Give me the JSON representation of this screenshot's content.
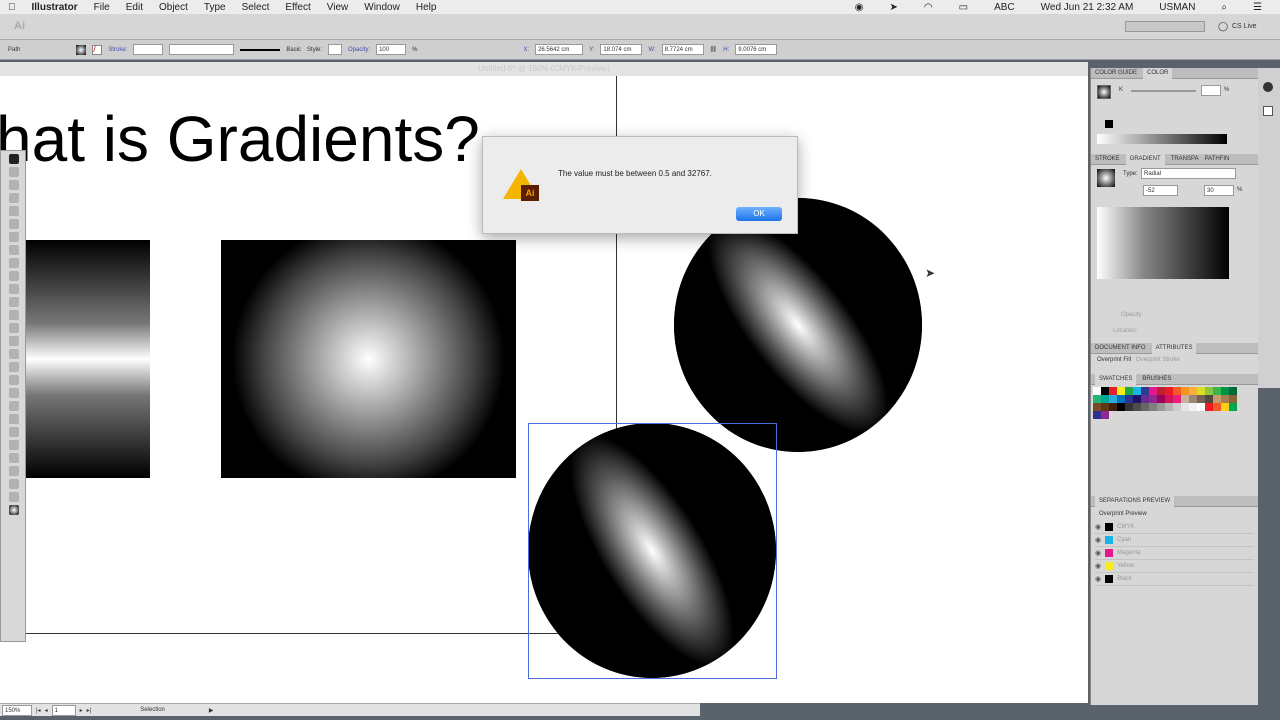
{
  "menubar": {
    "app": "Illustrator",
    "items": [
      "File",
      "Edit",
      "Object",
      "Type",
      "Select",
      "Effect",
      "View",
      "Window",
      "Help"
    ],
    "input_source": "ABC",
    "datetime": "Wed Jun 21  2:32 AM",
    "user": "USMAN"
  },
  "appbar": {
    "cs_live": "CS Live"
  },
  "control": {
    "selection_type": "Path",
    "stroke_label": "Stroke:",
    "stroke_style": "Basic",
    "style_label": "Style:",
    "opacity_label": "Opacity:",
    "opacity_value": "100",
    "opacity_unit": "%",
    "x_label": "X:",
    "x_value": "26.5642 cm",
    "y_label": "Y:",
    "y_value": "18.074 cm",
    "w_label": "W:",
    "w_value": "8.7724 cm",
    "h_label": "H:",
    "h_value": "9.0076 cm"
  },
  "document": {
    "tab_title": "Untitled-5* @ 150% (CMYK/Preview)",
    "heading_text": "hat is Gradients?"
  },
  "dialog": {
    "message": "The value must be between 0.5 and 32767.",
    "ok_label": "OK",
    "icon": "illustrator-warning-icon"
  },
  "panels": {
    "color": {
      "tabs": [
        "COLOR GUIDE",
        "COLOR"
      ],
      "channel": "K",
      "unit": "%"
    },
    "gradient": {
      "tabs": [
        "STROKE",
        "GRADIENT",
        "TRANSPA",
        "PATHFIN"
      ],
      "type_label": "Type:",
      "type_value": "Radial",
      "angle_value": "-52",
      "aspect_value": "30",
      "unit": "%",
      "opacity_label": "Opacity:",
      "location_label": "Location:"
    },
    "attributes": {
      "tabs": [
        "DOCUMENT INFO",
        "ATTRIBUTES"
      ],
      "overprint_fill": "Overprint Fill",
      "overprint_stroke": "Overprint Stroke"
    },
    "swatches": {
      "tabs": [
        "SWATCHES",
        "BRUSHES"
      ],
      "colors": [
        "#ffffff",
        "#000000",
        "#e8202a",
        "#f7ec1c",
        "#1aa84a",
        "#1ab4e8",
        "#2b3990",
        "#e6168b",
        "#be1e2d",
        "#ec1c24",
        "#f15a24",
        "#f7931e",
        "#fbb03b",
        "#d9e021",
        "#8cc63f",
        "#39b54a",
        "#009245",
        "#006837",
        "#22b573",
        "#00a99d",
        "#29abe2",
        "#0071bc",
        "#2e3192",
        "#1b1464",
        "#662d91",
        "#93278f",
        "#9e005d",
        "#d4145a",
        "#ed1e79",
        "#c7b299",
        "#998675",
        "#736357",
        "#534741",
        "#c69c6d",
        "#a67c52",
        "#8c6239",
        "#754c24",
        "#603813",
        "#42210b",
        "#000000",
        "#333333",
        "#4d4d4d",
        "#666666",
        "#808080",
        "#999999",
        "#b3b3b3",
        "#cccccc",
        "#e6e6e6",
        "#f2f2f2",
        "#ffffff",
        "#ed1c24",
        "#f15a24",
        "#fcd116",
        "#00a651",
        "#2e3192",
        "#92278f"
      ]
    },
    "separations": {
      "title": "SEPARATIONS PREVIEW",
      "overprint_preview": "Overprint Preview",
      "plates": [
        {
          "name": "CMYK",
          "color": "#000000"
        },
        {
          "name": "Cyan",
          "color": "#1ab4e8"
        },
        {
          "name": "Magenta",
          "color": "#e6168b"
        },
        {
          "name": "Yellow",
          "color": "#f7ec1c"
        },
        {
          "name": "Black",
          "color": "#000000"
        }
      ]
    }
  },
  "status": {
    "zoom": "150%",
    "artboard": "1",
    "tool": "Selection"
  }
}
